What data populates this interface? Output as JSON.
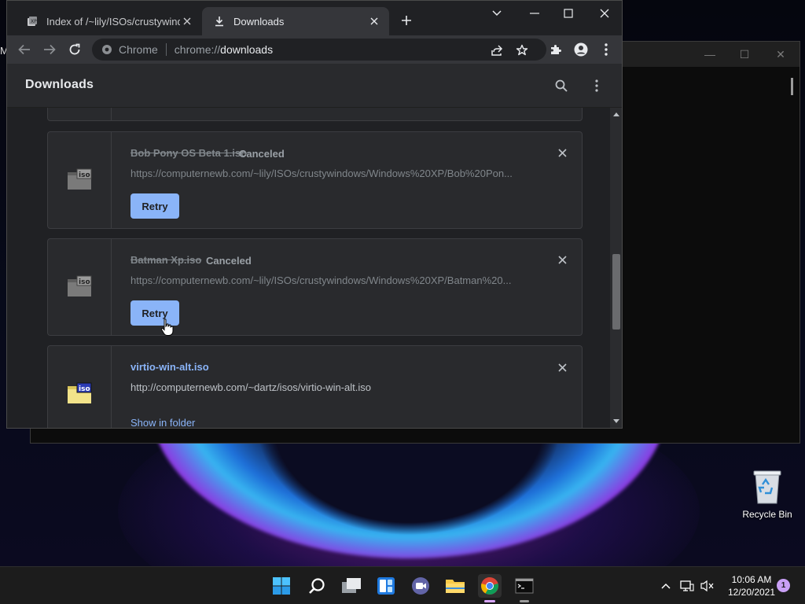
{
  "chrome": {
    "tabs": [
      {
        "title": "Index of /~lily/ISOs/crustywindows/Windows XP",
        "active": false
      },
      {
        "title": "Downloads",
        "active": true
      }
    ],
    "omnibox": {
      "origin": "Chrome",
      "scheme": "chrome://",
      "host": "downloads"
    }
  },
  "downloads": {
    "title": "Downloads",
    "items": [
      {
        "name": "Bob Pony OS Beta 1.iso",
        "status": "Canceled",
        "url": "https://computernewb.com/~lily/ISOs/crustywindows/Windows%20XP/Bob%20Pon...",
        "action": "Retry"
      },
      {
        "name": "Batman Xp.iso",
        "status": "Canceled",
        "url": "https://computernewb.com/~lily/ISOs/crustywindows/Windows%20XP/Batman%20...",
        "action": "Retry"
      },
      {
        "name": "virtio-win-alt.iso",
        "status": "",
        "url": "http://computernewb.com/~dartz/isos/virtio-win-alt.iso",
        "action": "Show in folder"
      }
    ]
  },
  "desktop": {
    "recycle_bin": "Recycle Bin"
  },
  "back_window": {
    "edge_letter": "M"
  },
  "taskbar": {
    "time": "10:06 AM",
    "date": "12/20/2021",
    "notification_count": "1"
  },
  "colors": {
    "accent": "#8ab4f8",
    "page_bg": "#202124",
    "card_bg": "#292a2d"
  }
}
